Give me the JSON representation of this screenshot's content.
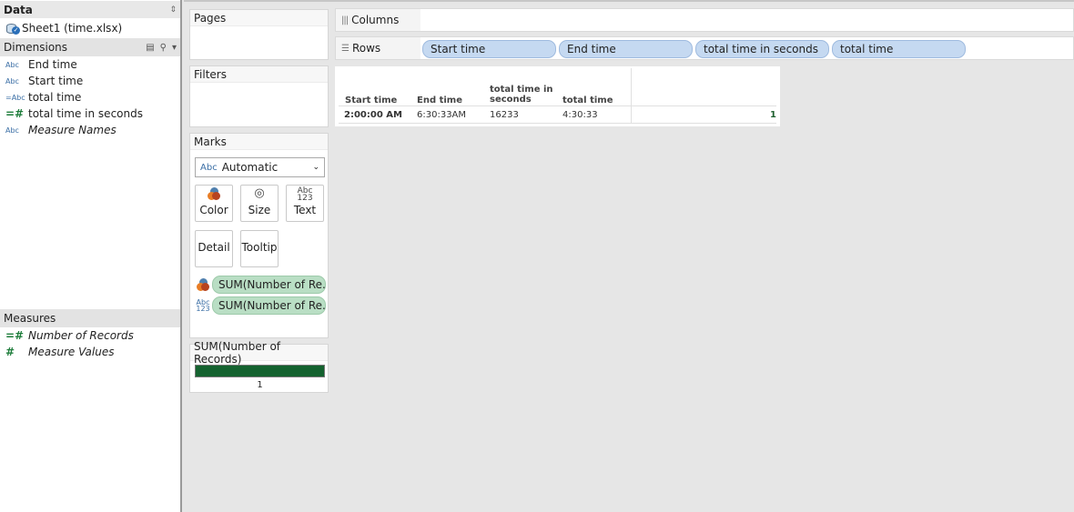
{
  "data_pane": {
    "title": "Data",
    "sort_glyph": "⇕",
    "datasource": "Sheet1 (time.xlsx)",
    "dimensions_label": "Dimensions",
    "dimensions": [
      {
        "type": "Abc",
        "name": "End time"
      },
      {
        "type": "Abc",
        "name": "Start time"
      },
      {
        "type": "=Abc",
        "name": "total time"
      },
      {
        "type": "=#",
        "name": "total time in seconds"
      },
      {
        "type": "Abc",
        "name": "Measure Names"
      }
    ],
    "measures_label": "Measures",
    "measures": [
      {
        "type": "=#",
        "name": "Number of Records"
      },
      {
        "type": "#",
        "name": "Measure Values"
      }
    ]
  },
  "cards": {
    "pages": "Pages",
    "filters": "Filters",
    "marks": "Marks",
    "mark_type": "Automatic",
    "mark_type_icon": "Abc",
    "buttons": {
      "color": "Color",
      "size": "Size",
      "text": "Text",
      "detail": "Detail",
      "tooltip": "Tooltip"
    },
    "mark_pills": [
      "SUM(Number of Re..",
      "SUM(Number of Re.."
    ],
    "legend_title": "SUM(Number of Records)",
    "legend_value": "1",
    "legend_color": "#14622f"
  },
  "shelves": {
    "columns_label": "Columns",
    "rows_label": "Rows",
    "row_pills": [
      "Start time",
      "End time",
      "total time in seconds",
      "total time"
    ]
  },
  "table": {
    "headers": [
      "Start time",
      "End time",
      "total time in seconds",
      "total time"
    ],
    "row": [
      "2:00:00 AM",
      "6:30:33AM",
      "16233",
      "4:30:33"
    ],
    "value": "1"
  }
}
